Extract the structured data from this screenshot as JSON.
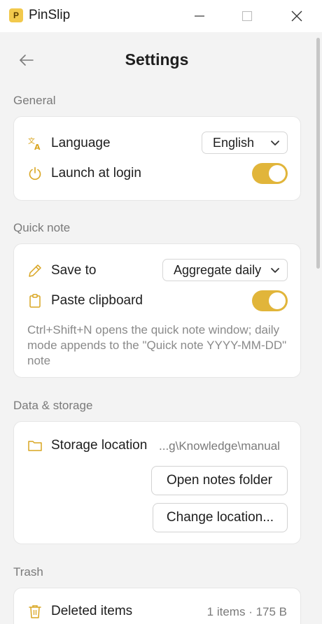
{
  "window": {
    "title": "PinSlip",
    "app_icon_letter": "P"
  },
  "header": {
    "title": "Settings"
  },
  "sections": {
    "general": {
      "label": "General",
      "language": {
        "label": "Language",
        "value": "English"
      },
      "launch_at_login": {
        "label": "Launch at login",
        "enabled": true
      }
    },
    "quick_note": {
      "label": "Quick note",
      "save_to": {
        "label": "Save to",
        "value": "Aggregate daily"
      },
      "paste_clipboard": {
        "label": "Paste clipboard",
        "enabled": true
      },
      "hint": "Ctrl+Shift+N opens the quick note window; daily mode appends to the \"Quick note YYYY-MM-DD\" note"
    },
    "data_storage": {
      "label": "Data & storage",
      "storage_location": {
        "label": "Storage location",
        "value": "...g\\Knowledge\\manual"
      },
      "open_folder_button": "Open notes folder",
      "change_location_button": "Change location..."
    },
    "trash": {
      "label": "Trash",
      "deleted_items": {
        "label": "Deleted items",
        "value": "1 items · 175 B"
      }
    }
  },
  "colors": {
    "accent": "#e1b53a",
    "icon_accent": "#d9a521",
    "background": "#f3f3f3",
    "card": "#ffffff"
  },
  "icons": {
    "app": "pinslip-app-icon",
    "minimize": "minimize-icon",
    "maximize": "maximize-icon",
    "close": "close-icon",
    "back": "arrow-left-icon",
    "language": "translate-icon",
    "launch": "power-icon",
    "save_to": "pencil-icon",
    "paste": "clipboard-icon",
    "storage": "folder-icon",
    "trash": "trash-icon"
  }
}
